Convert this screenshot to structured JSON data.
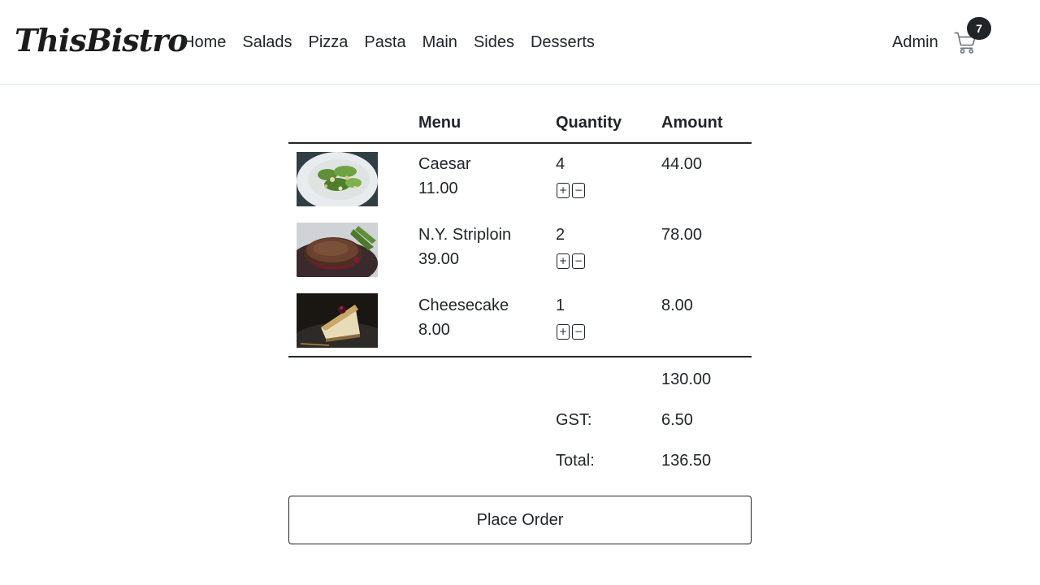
{
  "brand": "ThisBistro",
  "nav": {
    "links": [
      "Home",
      "Salads",
      "Pizza",
      "Pasta",
      "Main",
      "Sides",
      "Desserts"
    ],
    "user": "Admin",
    "cart_count": "7"
  },
  "table": {
    "headers": {
      "image": "",
      "menu": "Menu",
      "quantity": "Quantity",
      "amount": "Amount"
    },
    "items": [
      {
        "name": "Caesar",
        "price": "11.00",
        "quantity": "4",
        "amount": "44.00",
        "image": "caesar-salad-photo"
      },
      {
        "name": "N.Y. Striploin",
        "price": "39.00",
        "quantity": "2",
        "amount": "78.00",
        "image": "steak-photo"
      },
      {
        "name": "Cheesecake",
        "price": "8.00",
        "quantity": "1",
        "amount": "8.00",
        "image": "cheesecake-photo"
      }
    ],
    "plus_label": "+",
    "minus_label": "−"
  },
  "summary": {
    "subtotal": "130.00",
    "gst_label": "GST:",
    "gst": "6.50",
    "total_label": "Total:",
    "total": "136.50"
  },
  "place_order_label": "Place Order",
  "colors": {
    "text": "#212529",
    "border": "#dee2e6",
    "badge": "#212529"
  }
}
